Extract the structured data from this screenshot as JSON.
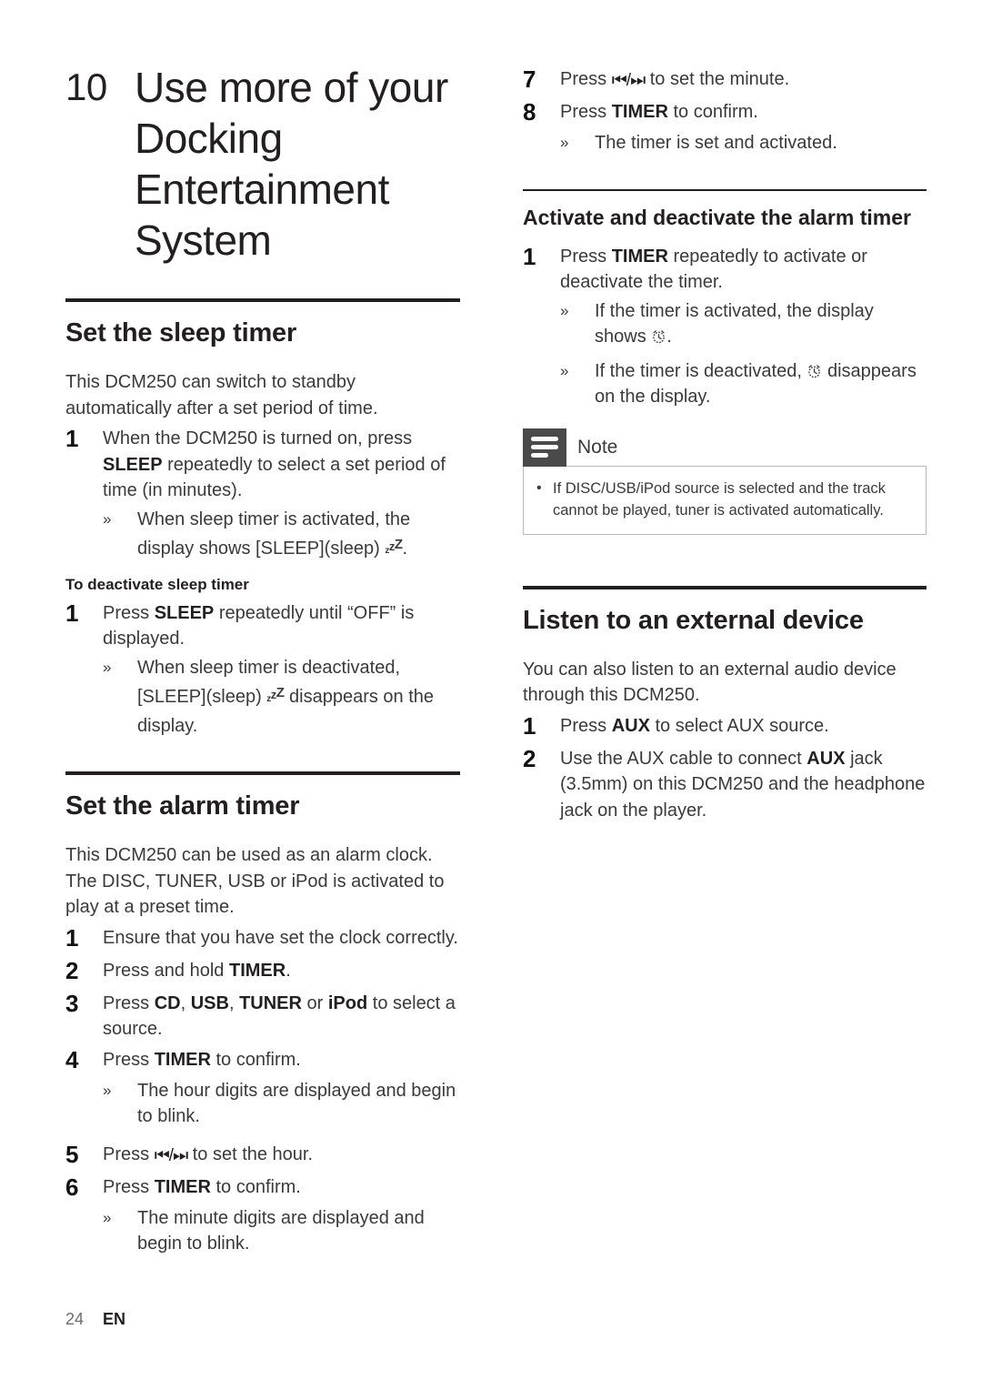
{
  "document": {
    "footer": {
      "page_number": "24",
      "language": "EN"
    }
  },
  "chapter": {
    "number": "10",
    "title": "Use more of your Docking Entertainment System"
  },
  "glyphs": {
    "sleep_zzz": "zᶻᶻ",
    "prev_next": "⏮/⏭",
    "alarm_clock": "alarm-clock-glyph"
  },
  "left_column": {
    "sections": [
      {
        "id": "set-the-sleep-timer",
        "heading": "Set the sleep timer",
        "intro": "This DCM250 can switch to standby automatically after a set period of time.",
        "steps": [
          {
            "num": "1",
            "text_parts": [
              "When the DCM250 is turned on, press ",
              "SLEEP",
              " repeatedly to select a set period of time (in minutes)."
            ],
            "bold_index": 1,
            "results": [
              {
                "mark": "»",
                "text_before": "When sleep timer is activated, the display shows [SLEEP](sleep) ",
                "glyph": "sleep_zzz",
                "text_after": "."
              }
            ]
          }
        ],
        "sub_heading": "To deactivate sleep timer",
        "sub_steps": [
          {
            "num": "1",
            "text_parts": [
              "Press ",
              "SLEEP",
              " repeatedly until “OFF” is displayed."
            ],
            "bold_index": 1,
            "results": [
              {
                "mark": "»",
                "text_before": "When sleep timer is deactivated, [SLEEP](sleep) ",
                "glyph": "sleep_zzz",
                "text_after": " disappears on the display."
              }
            ]
          }
        ]
      },
      {
        "id": "set-the-alarm-timer",
        "heading": "Set the alarm timer",
        "intro": "This DCM250 can be used as an alarm clock. The DISC, TUNER, USB or iPod is activated to play at a preset time.",
        "steps": [
          {
            "num": "1",
            "text": "Ensure that you have set the clock correctly."
          },
          {
            "num": "2",
            "text_before": "Press and hold ",
            "bold": "TIMER",
            "text_after": "."
          },
          {
            "num": "3",
            "text_before": "Press ",
            "bold_list": [
              "CD",
              "USB",
              "TUNER",
              "iPod"
            ],
            "text_after": " to select a source."
          },
          {
            "num": "4",
            "text_before": "Press ",
            "bold": "TIMER",
            "text_after": " to confirm.",
            "results": [
              {
                "mark": "»",
                "text": "The hour digits are displayed and begin to blink."
              }
            ]
          },
          {
            "num": "5",
            "text_before": "Press ",
            "glyph": "prev_next",
            "text_after": " to set the hour."
          },
          {
            "num": "6",
            "text_before": "Press ",
            "bold": "TIMER",
            "text_after": " to confirm.",
            "results": [
              {
                "mark": "»",
                "text": "The minute digits are displayed and begin to blink."
              }
            ]
          }
        ]
      }
    ]
  },
  "right_column": {
    "continued_steps": [
      {
        "num": "7",
        "text_before": "Press ",
        "glyph": "prev_next",
        "text_after": " to set the minute."
      },
      {
        "num": "8",
        "text_before": "Press ",
        "bold": "TIMER",
        "text_after": " to confirm.",
        "results": [
          {
            "mark": "»",
            "text": "The timer is set and activated."
          }
        ]
      }
    ],
    "sections": [
      {
        "id": "activate-deactivate-alarm-timer",
        "heading": "Activate and deactivate the alarm timer",
        "steps": [
          {
            "num": "1",
            "text_before": "Press ",
            "bold": "TIMER",
            "text_after": " repeatedly to activate or deactivate the timer.",
            "results": [
              {
                "mark": "»",
                "text_before": "If the timer is activated, the display shows ",
                "glyph": "alarm_clock",
                "text_after": "."
              },
              {
                "mark": "»",
                "text_before": "If the timer is deactivated, ",
                "glyph": "alarm_clock",
                "text_after": " disappears on the display."
              }
            ]
          }
        ],
        "note": {
          "label": "Note",
          "items": [
            "If DISC/USB/iPod source is selected and the track cannot be played, tuner is activated automatically."
          ]
        }
      },
      {
        "id": "listen-to-an-external-device",
        "heading": "Listen to an external device",
        "intro": "You can also listen to an external audio device through this DCM250.",
        "steps": [
          {
            "num": "1",
            "text_before": "Press ",
            "bold": "AUX",
            "text_after": " to select AUX source."
          },
          {
            "num": "2",
            "text_before": "Use the AUX cable to connect ",
            "bold": "AUX",
            "text_after": " jack (3.5mm) on this DCM250 and the headphone jack on the player."
          }
        ]
      }
    ]
  },
  "colors": {
    "text": "#231f20",
    "body_text": "#3a3a3a",
    "rule": "#231f20",
    "note_icon_bg": "#4a4a4a",
    "note_border": "#b9b9b9",
    "footer_page": "#6d6d6d"
  }
}
